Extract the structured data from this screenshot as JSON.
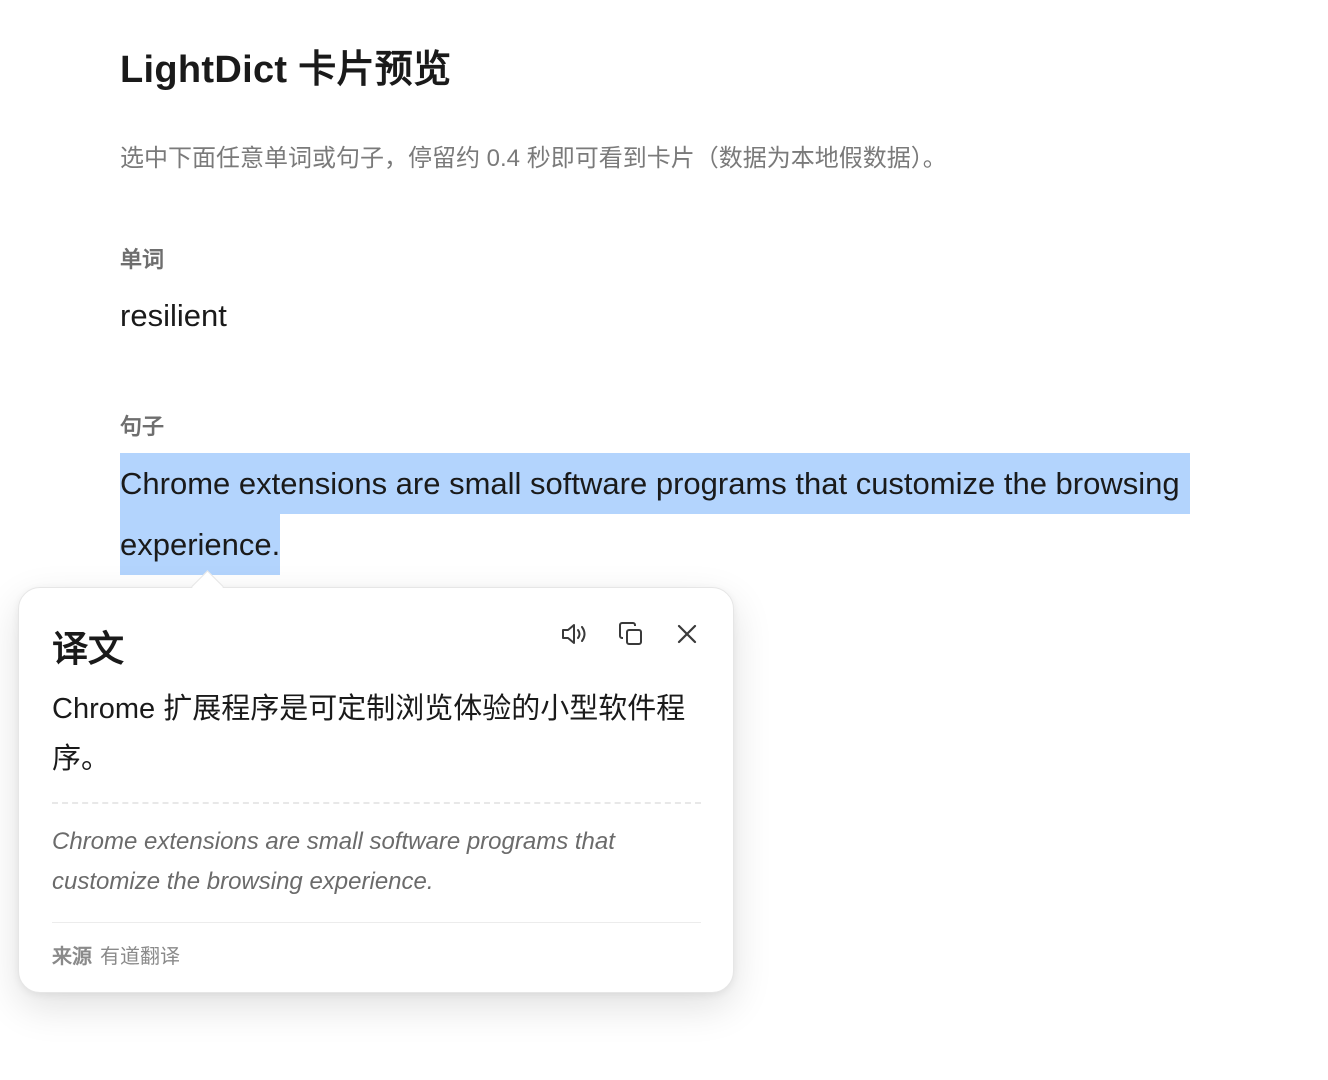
{
  "page": {
    "title": "LightDict 卡片预览",
    "subtitle": "选中下面任意单词或句子，停留约 0.4 秒即可看到卡片（数据为本地假数据）。",
    "word_section_label": "单词",
    "word": "resilient",
    "sentence_section_label": "句子",
    "sentence_line1": "Chrome extensions are small software programs that customize the browsing",
    "sentence_line2": "experience."
  },
  "card": {
    "title": "译文",
    "actions": [
      {
        "name": "speaker-icon"
      },
      {
        "name": "copy-icon"
      },
      {
        "name": "close-icon"
      }
    ],
    "translation": "Chrome 扩展程序是可定制浏览体验的小型软件程序。",
    "original": "Chrome extensions are small software programs that customize the browsing experience.",
    "source_label": "来源",
    "source_value": "有道翻译"
  },
  "colors": {
    "selection": "#b3d4fd",
    "text": "#1a1a1a",
    "muted": "#7a7a7a"
  }
}
